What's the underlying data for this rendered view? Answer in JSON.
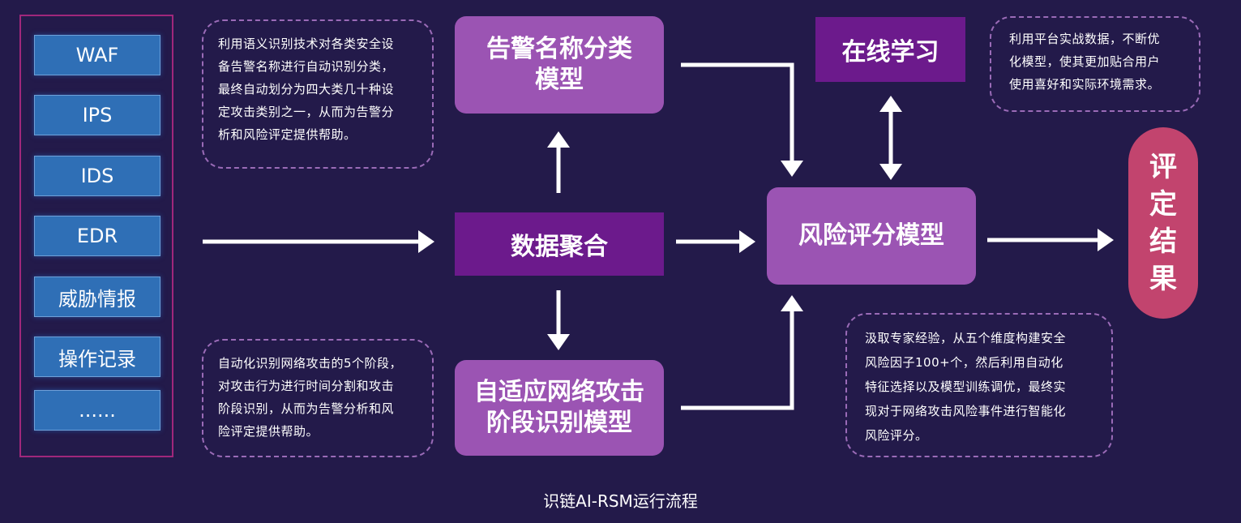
{
  "sources": [
    "WAF",
    "IPS",
    "IDS",
    "EDR",
    "威胁情报",
    "操作记录",
    "......"
  ],
  "nodes": {
    "alert_classify": [
      "告警名称分类",
      "模型"
    ],
    "data_aggregation": "数据聚合",
    "adaptive_stage": [
      "自适应网络攻击",
      "阶段识别模型"
    ],
    "online_learning": "在线学习",
    "risk_scoring": "风险评分模型",
    "result": [
      "评",
      "定",
      "结",
      "果"
    ]
  },
  "descriptions": {
    "alert_classify": [
      "利用语义识别技术对各类安全设",
      "备告警名称进行自动识别分类，",
      "最终自动划分为四大类几十种设",
      "定攻击类别之一，从而为告警分",
      "析和风险评定提供帮助。"
    ],
    "adaptive_stage": [
      "自动化识别网络攻击的5个阶段，",
      "对攻击行为进行时间分割和攻击",
      "阶段识别，从而为告警分析和风",
      "险评定提供帮助。"
    ],
    "online_learning": [
      "利用平台实战数据，不断优",
      "化模型，使其更加贴合用户",
      "使用喜好和实际环境需求。"
    ],
    "risk_scoring": [
      "汲取专家经验，从五个维度构建安全",
      "风险因子100+个，然后利用自动化",
      "特征选择以及模型训练调优，最终实",
      "现对于网络攻击风险事件进行智能化",
      "风险评分。"
    ]
  },
  "caption": "识链AI-RSM运行流程",
  "colors": {
    "background": "#231a4a",
    "source_box": "#2f6fb6",
    "light_box": "#9b54b3",
    "dark_box": "#6c1a8c",
    "result": "#c2446e",
    "frame": "#a0277b"
  }
}
